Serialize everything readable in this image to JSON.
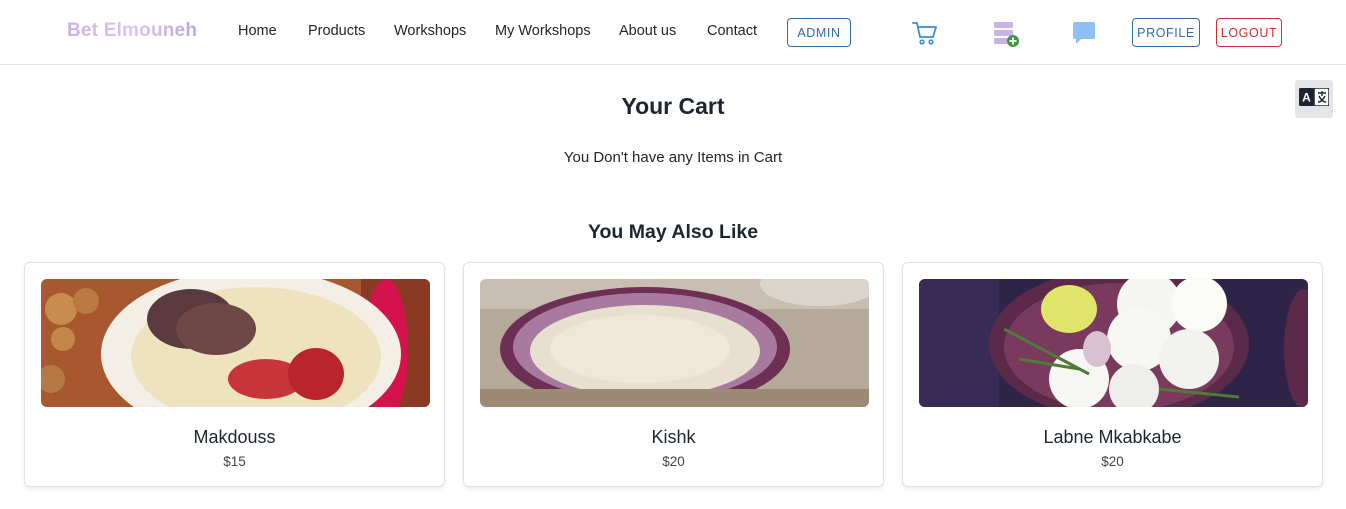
{
  "navbar": {
    "brand": "Bet Elmouneh",
    "links": [
      "Home",
      "Products",
      "Workshops",
      "My Workshops",
      "About us",
      "Contact"
    ],
    "admin_label": "ADMIN",
    "profile_label": "PROFILE",
    "logout_label": "LOGOUT",
    "icons": [
      "cart-icon",
      "add-database-icon",
      "chat-icon"
    ]
  },
  "translate_icon": "translate-icon",
  "cart": {
    "title": "Your Cart",
    "empty_message": "You Don't have any Items in Cart"
  },
  "recommendations": {
    "title": "You May Also Like",
    "products": [
      {
        "name": "Makdouss",
        "price": "$15",
        "image": "makdouss-photo"
      },
      {
        "name": "Kishk",
        "price": "$20",
        "image": "kishk-photo"
      },
      {
        "name": "Labne Mkabkabe",
        "price": "$20",
        "image": "labne-photo"
      }
    ]
  },
  "colors": {
    "primary": "#2e6fa7",
    "danger": "#c9302c",
    "brand_gradient_start": "#c9b3e6",
    "cart_icon": "#3b8fd8",
    "chat_icon": "#8ec0f5"
  }
}
